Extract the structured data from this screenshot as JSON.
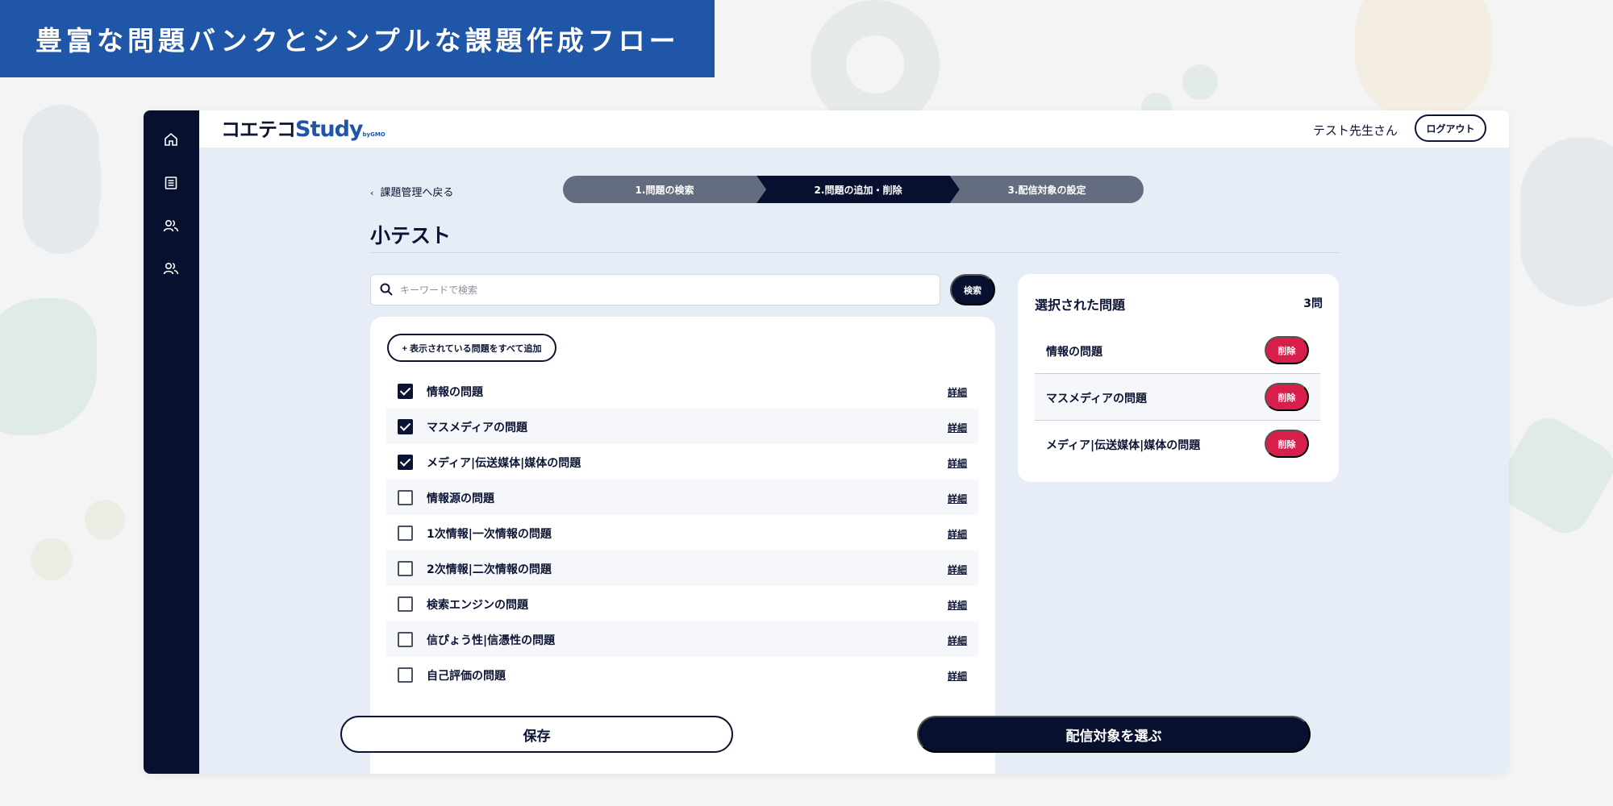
{
  "banner": {
    "title": "豊富な問題バンクとシンプルな課題作成フロー"
  },
  "header": {
    "logo_main": "コエテコ",
    "logo_accent": "Study",
    "logo_suffix": "byGMO",
    "user_name": "テスト先生さん",
    "logout_label": "ログアウト"
  },
  "sidebar": {
    "items": [
      {
        "icon": "home-icon"
      },
      {
        "icon": "list-icon"
      },
      {
        "icon": "users-icon"
      },
      {
        "icon": "users-icon"
      }
    ]
  },
  "nav": {
    "back_label": "課題管理へ戻る"
  },
  "steps": [
    {
      "label": "1.問題の検索",
      "active": false
    },
    {
      "label": "2.問題の追加・削除",
      "active": true
    },
    {
      "label": "3.配信対象の設定",
      "active": false
    }
  ],
  "page": {
    "title": "小テスト"
  },
  "search": {
    "placeholder": "キーワードで検索",
    "value": "",
    "button_label": "検索"
  },
  "question_list": {
    "add_all_label": "+ 表示されている問題をすべて追加",
    "detail_label": "詳細",
    "items": [
      {
        "label": "情報の問題",
        "checked": true
      },
      {
        "label": "マスメディアの問題",
        "checked": true
      },
      {
        "label": "メディア|伝送媒体|媒体の問題",
        "checked": true
      },
      {
        "label": "情報源の問題",
        "checked": false
      },
      {
        "label": "1次情報|一次情報の問題",
        "checked": false
      },
      {
        "label": "2次情報|二次情報の問題",
        "checked": false
      },
      {
        "label": "検索エンジンの問題",
        "checked": false
      },
      {
        "label": "信ぴょう性|信憑性の問題",
        "checked": false
      },
      {
        "label": "自己評価の問題",
        "checked": false
      }
    ]
  },
  "selected": {
    "title": "選択された問題",
    "count": "3問",
    "delete_label": "削除",
    "items": [
      {
        "label": "情報の問題"
      },
      {
        "label": "マスメディアの問題"
      },
      {
        "label": "メディア|伝送媒体|媒体の問題"
      }
    ]
  },
  "footer": {
    "save_label": "保存",
    "next_label": "配信対象を選ぶ"
  },
  "colors": {
    "banner": "#1f56a8",
    "navy": "#07112f",
    "step_inactive": "#646d80",
    "delete": "#d81e4b",
    "content_bg": "#e7edf7"
  }
}
